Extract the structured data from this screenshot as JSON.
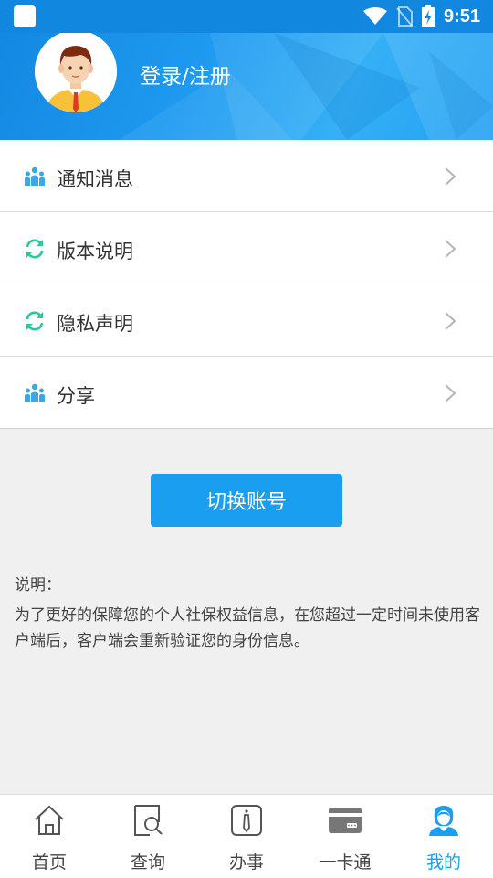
{
  "status_bar": {
    "time": "9:51"
  },
  "header": {
    "login_label": "登录/注册"
  },
  "menu": {
    "items": [
      {
        "label": "通知消息",
        "icon": "people-icon"
      },
      {
        "label": "版本说明",
        "icon": "refresh-icon"
      },
      {
        "label": "隐私声明",
        "icon": "refresh-icon"
      },
      {
        "label": "分享",
        "icon": "people-icon"
      }
    ]
  },
  "switch_button": {
    "label": "切换账号"
  },
  "note": {
    "title": "说明：",
    "body": "为了更好的保障您的个人社保权益信息，在您超过一定时间未使用客户端后，客户端会重新验证您的身份信息。"
  },
  "tabbar": {
    "items": [
      {
        "label": "首页",
        "icon": "home-icon"
      },
      {
        "label": "查询",
        "icon": "search-doc-icon"
      },
      {
        "label": "办事",
        "icon": "tie-icon"
      },
      {
        "label": "一卡通",
        "icon": "card-icon"
      },
      {
        "label": "我的",
        "icon": "user-icon",
        "active": true
      }
    ]
  },
  "colors": {
    "accent": "#1a9eef",
    "header": "#1e9af0",
    "icon_people": "#3aa8e6",
    "icon_refresh": "#2bc7a0"
  }
}
